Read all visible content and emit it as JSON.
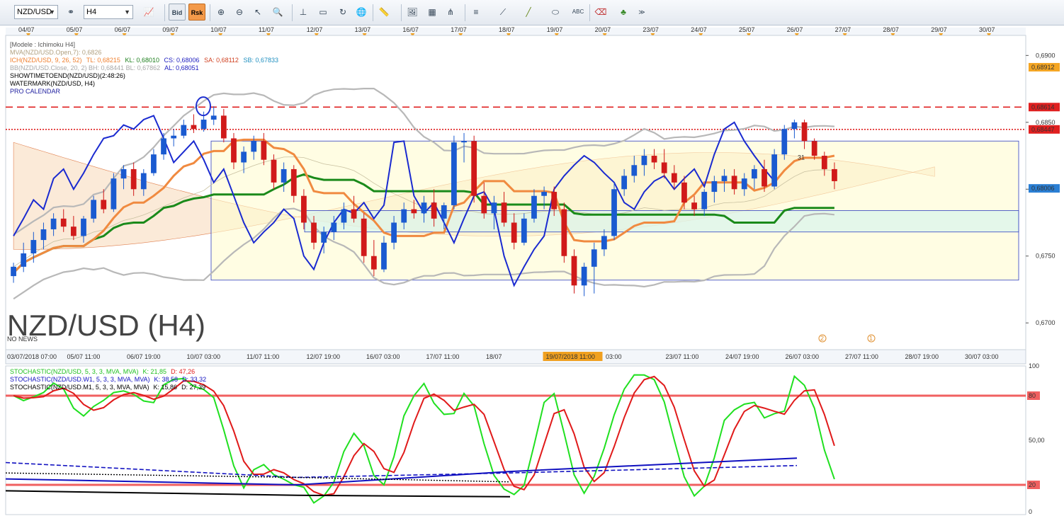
{
  "toolbar": {
    "symbol": "NZD/USD",
    "timeframe": "H4",
    "bid_label": "Bid",
    "ask_label": "Rsk",
    "icons": [
      "link-icon",
      "chart-type-icon",
      "cursor-icon",
      "zoom-icon",
      "line-tool-icon",
      "text-tool-icon",
      "globe-icon",
      "ruler-icon",
      "image-icon",
      "grid-icon",
      "pitchfork-icon",
      "trend-line-icon",
      "ellipse-icon",
      "abc-icon",
      "eraser-icon",
      "tree-icon",
      "more-icon"
    ]
  },
  "top_dates": [
    "04/07",
    "05/07",
    "06/07",
    "09/07",
    "10/07",
    "11/07",
    "12/07",
    "13/07",
    "16/07",
    "17/07",
    "18/07",
    "19/07",
    "20/07",
    "23/07",
    "24/07",
    "25/07",
    "26/07",
    "27/07",
    "28/07",
    "29/07",
    "30/07"
  ],
  "bottom_dates": [
    "03/07/2018 07:00",
    "05/07 11:00",
    "06/07 19:00",
    "10/07 03:00",
    "11/07 11:00",
    "12/07 19:00",
    "16/07 03:00",
    "17/07 11:00",
    "18/07",
    "19/07/2018 11:00",
    "03:00",
    "23/07 11:00",
    "24/07 19:00",
    "26/07 03:00",
    "27/07 11:00",
    "28/07 19:00",
    "30/07 03:00"
  ],
  "price_panel": {
    "legend": {
      "model": "[Modele : Ichimoku H4]",
      "mva": "MVA(NZD/USD.Open,7): 0,6826",
      "ich_name": "ICH(NZD/USD, 9, 26, 52)",
      "ich_tl": "TL: 0,68215",
      "ich_kl": "KL: 0,68010",
      "ich_cs": "CS: 0,68006",
      "ich_sa": "SA: 0,68112",
      "ich_sb": "SB: 0,67833",
      "bb": "BB(NZD/USD.Close, 20, 2)  BH: 0,68441  BL: 0,67862",
      "bb_al": "AL: 0,68051",
      "showtime": "SHOWTIMETOEND(NZD/USD)(2:48:26)",
      "watermark_ind": "WATERMARK(NZD/USD, H4)",
      "calendar": "PRO CALENDAR"
    },
    "watermark": "NZD/USD (H4)",
    "no_news": "NO NEWS",
    "y_ticks": [
      "0,6900",
      "0,6850",
      "0,6800",
      "0,6750",
      "0,6700"
    ],
    "price_tags": [
      {
        "text": "0,68912",
        "color": "#f5a623"
      },
      {
        "text": "0,68614",
        "color": "#e02020"
      },
      {
        "text": "0,68447",
        "color": "#e02020"
      },
      {
        "text": "0,68006",
        "color": "#2a7fd4"
      }
    ],
    "annotations": {
      "candle_label": "31",
      "event_1": "2",
      "event_2": "1"
    }
  },
  "stoch_panel": {
    "legend": [
      {
        "text": "STOCHASTIC(NZD/USD, 5, 3, 3, MVA, MVA)",
        "k": "K: 21,85",
        "d": "D: 47,26",
        "color": "#20c020"
      },
      {
        "text": "STOCHASTIC(NZD/USD.W1, 5, 3, 3, MVA, MVA)",
        "k": "K: 38,58",
        "d": "D: 33,32",
        "color": "#1010c0"
      },
      {
        "text": "STOCHASTIC(NZD/USD.M1, 5, 3, 3, MVA, MVA)",
        "k": "K: 15,86",
        "d": "D: 27,39",
        "color": "#000000"
      }
    ],
    "y_ticks": [
      "100",
      "80",
      "50,00",
      "20",
      "0"
    ]
  },
  "chart_data": {
    "type": "candlestick",
    "symbol": "NZD/USD",
    "timeframe": "H4",
    "ylim": [
      0.668,
      0.6915
    ],
    "candles": [
      [
        0.6735,
        0.6745,
        0.673,
        0.6742
      ],
      [
        0.6742,
        0.676,
        0.6738,
        0.6752
      ],
      [
        0.6752,
        0.6768,
        0.6745,
        0.6762
      ],
      [
        0.6762,
        0.6775,
        0.6755,
        0.677
      ],
      [
        0.677,
        0.6782,
        0.6765,
        0.6778
      ],
      [
        0.6778,
        0.6785,
        0.6768,
        0.6772
      ],
      [
        0.6772,
        0.678,
        0.6762,
        0.6765
      ],
      [
        0.6765,
        0.678,
        0.676,
        0.6778
      ],
      [
        0.6778,
        0.6795,
        0.6775,
        0.6792
      ],
      [
        0.6792,
        0.68,
        0.6782,
        0.6785
      ],
      [
        0.6785,
        0.6812,
        0.6783,
        0.6808
      ],
      [
        0.6808,
        0.6818,
        0.68,
        0.6815
      ],
      [
        0.6815,
        0.682,
        0.6795,
        0.68
      ],
      [
        0.68,
        0.6815,
        0.6795,
        0.6812
      ],
      [
        0.6812,
        0.683,
        0.681,
        0.6826
      ],
      [
        0.6826,
        0.6842,
        0.6822,
        0.6838
      ],
      [
        0.6838,
        0.6845,
        0.6832,
        0.684
      ],
      [
        0.684,
        0.6852,
        0.6838,
        0.6848
      ],
      [
        0.6848,
        0.6856,
        0.6842,
        0.6845
      ],
      [
        0.6845,
        0.6858,
        0.6843,
        0.6852
      ],
      [
        0.6852,
        0.6862,
        0.6848,
        0.6855
      ],
      [
        0.6855,
        0.686,
        0.6835,
        0.6838
      ],
      [
        0.6838,
        0.6842,
        0.6815,
        0.682
      ],
      [
        0.682,
        0.6832,
        0.6812,
        0.6828
      ],
      [
        0.6828,
        0.684,
        0.6822,
        0.6836
      ],
      [
        0.6836,
        0.6842,
        0.6818,
        0.6822
      ],
      [
        0.6822,
        0.6826,
        0.68,
        0.6805
      ],
      [
        0.6805,
        0.682,
        0.6798,
        0.6815
      ],
      [
        0.6815,
        0.6818,
        0.679,
        0.6795
      ],
      [
        0.6795,
        0.68,
        0.677,
        0.6775
      ],
      [
        0.6775,
        0.678,
        0.6755,
        0.676
      ],
      [
        0.676,
        0.6772,
        0.6752,
        0.6768
      ],
      [
        0.6768,
        0.678,
        0.6762,
        0.6775
      ],
      [
        0.6775,
        0.679,
        0.677,
        0.6785
      ],
      [
        0.6785,
        0.6795,
        0.6775,
        0.6778
      ],
      [
        0.6778,
        0.6782,
        0.6745,
        0.675
      ],
      [
        0.675,
        0.6762,
        0.6735,
        0.674
      ],
      [
        0.674,
        0.6765,
        0.6738,
        0.676
      ],
      [
        0.676,
        0.678,
        0.6755,
        0.6775
      ],
      [
        0.6775,
        0.679,
        0.677,
        0.6785
      ],
      [
        0.6785,
        0.6792,
        0.6778,
        0.6782
      ],
      [
        0.6782,
        0.6795,
        0.6775,
        0.679
      ],
      [
        0.679,
        0.68,
        0.6772,
        0.6778
      ],
      [
        0.6778,
        0.679,
        0.677,
        0.6788
      ],
      [
        0.6788,
        0.684,
        0.6785,
        0.6835
      ],
      [
        0.6835,
        0.6842,
        0.682,
        0.6836
      ],
      [
        0.6836,
        0.684,
        0.679,
        0.6795
      ],
      [
        0.6795,
        0.6805,
        0.6778,
        0.6782
      ],
      [
        0.6782,
        0.6795,
        0.677,
        0.679
      ],
      [
        0.679,
        0.6798,
        0.6772,
        0.6775
      ],
      [
        0.6775,
        0.6782,
        0.6755,
        0.676
      ],
      [
        0.676,
        0.6782,
        0.6758,
        0.6778
      ],
      [
        0.6778,
        0.68,
        0.6775,
        0.6795
      ],
      [
        0.6795,
        0.6802,
        0.6785,
        0.6798
      ],
      [
        0.6798,
        0.6802,
        0.678,
        0.6785
      ],
      [
        0.6785,
        0.679,
        0.6745,
        0.675
      ],
      [
        0.675,
        0.6755,
        0.6722,
        0.6728
      ],
      [
        0.6728,
        0.6745,
        0.672,
        0.6742
      ],
      [
        0.6742,
        0.676,
        0.6722,
        0.6755
      ],
      [
        0.6755,
        0.677,
        0.675,
        0.6765
      ],
      [
        0.6765,
        0.6805,
        0.6762,
        0.68
      ],
      [
        0.68,
        0.6815,
        0.6795,
        0.681
      ],
      [
        0.681,
        0.6825,
        0.6805,
        0.6818
      ],
      [
        0.6818,
        0.683,
        0.681,
        0.6825
      ],
      [
        0.6825,
        0.683,
        0.6815,
        0.682
      ],
      [
        0.682,
        0.683,
        0.6808,
        0.6812
      ],
      [
        0.6812,
        0.6818,
        0.68,
        0.6805
      ],
      [
        0.6805,
        0.681,
        0.6785,
        0.679
      ],
      [
        0.679,
        0.6795,
        0.678,
        0.6785
      ],
      [
        0.6785,
        0.68,
        0.678,
        0.6798
      ],
      [
        0.6798,
        0.681,
        0.679,
        0.6806
      ],
      [
        0.6806,
        0.6815,
        0.6798,
        0.681
      ],
      [
        0.681,
        0.6815,
        0.6796,
        0.68
      ],
      [
        0.68,
        0.6812,
        0.6795,
        0.6808
      ],
      [
        0.6808,
        0.6818,
        0.68,
        0.6815
      ],
      [
        0.6815,
        0.6822,
        0.6798,
        0.6802
      ],
      [
        0.6802,
        0.683,
        0.68,
        0.6826
      ],
      [
        0.6826,
        0.6848,
        0.6822,
        0.6845
      ],
      [
        0.6845,
        0.6852,
        0.6838,
        0.685
      ],
      [
        0.685,
        0.6852,
        0.683,
        0.6836
      ],
      [
        0.6836,
        0.6838,
        0.6822,
        0.6825
      ],
      [
        0.6825,
        0.6828,
        0.681,
        0.6815
      ],
      [
        0.6815,
        0.682,
        0.68,
        0.6806
      ]
    ],
    "indicators": [
      "MVA(7)",
      "Ichimoku(9,26,52)",
      "Bollinger(20,2)",
      "Stochastic(5,3,3)"
    ],
    "levels": [
      0.68614,
      0.68447
    ],
    "stochastic_levels": [
      80,
      20
    ],
    "stochastic_ylim": [
      0,
      100
    ]
  }
}
